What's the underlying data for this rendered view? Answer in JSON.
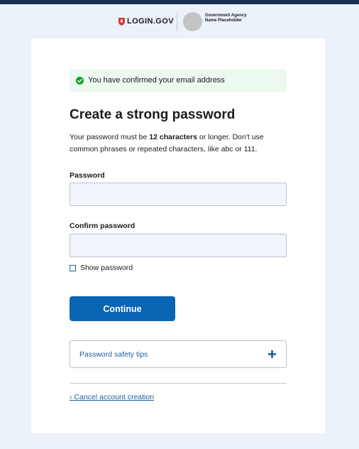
{
  "header": {
    "logo_text": "LOGIN.GOV",
    "agency_name": "Government Agency Name Placeholder"
  },
  "alert": {
    "message": "You have confirmed your email address",
    "icon": "check-circle-icon"
  },
  "form": {
    "title": "Create a strong password",
    "description": {
      "part1": "Your password must be ",
      "bold": "12 characters",
      "part2": " or longer. Don't use common phrases or repeated characters, like abc or 111."
    },
    "password_label": "Password",
    "password_value": "",
    "confirm_label": "Confirm password",
    "confirm_value": "",
    "show_password_label": "Show password",
    "show_password_checked": false,
    "continue_label": "Continue",
    "tips_label": "Password safety tips",
    "cancel_label": "‹ Cancel account creation"
  },
  "colors": {
    "top_bar": "#162e51",
    "background": "#ecf2f9",
    "primary_button": "#0a65b5",
    "success_bg": "#ecf9ee",
    "success_icon": "#00a91c",
    "link": "#1a5f9c",
    "logo_red": "#d83933"
  }
}
